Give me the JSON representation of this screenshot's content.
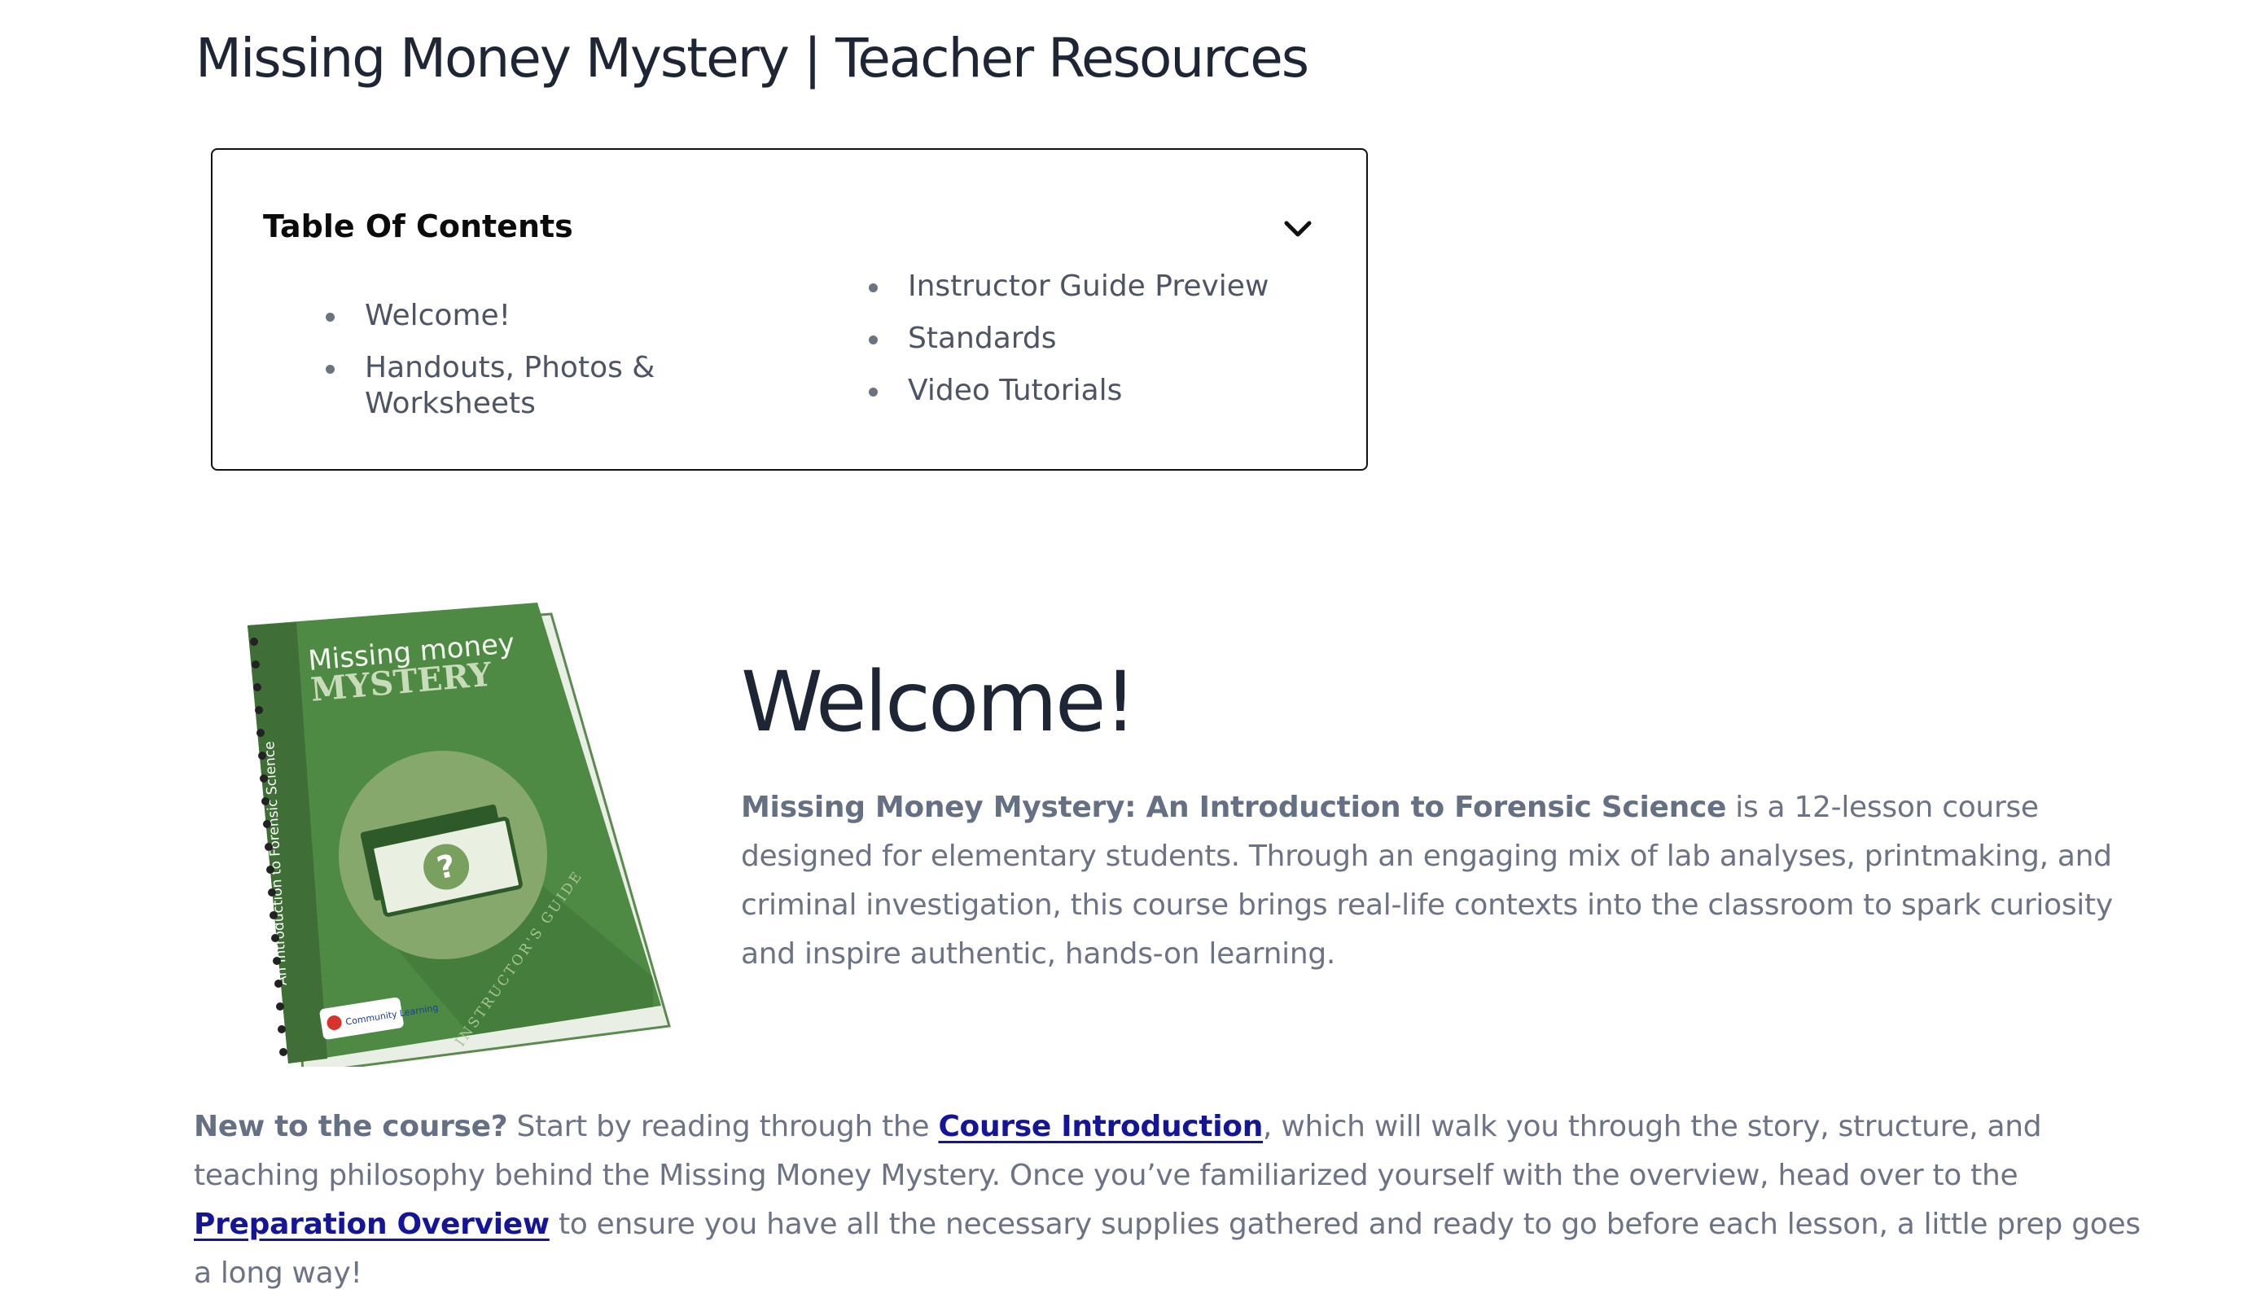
{
  "page": {
    "title": "Missing Money Mystery | Teacher Resources"
  },
  "toc": {
    "title": "Table Of Contents",
    "toggle_icon": "chevron-down-icon",
    "left_items": [
      "Welcome!",
      "Handouts, Photos & Worksheets"
    ],
    "right_items": [
      "Instructor Guide Preview",
      "Standards",
      "Video Tutorials"
    ]
  },
  "cover": {
    "title_line1": "Missing money",
    "title_line2": "MYSTERY",
    "spine_text": "An Introduction to Forensic Science",
    "badge_text": "INSTRUCTOR'S GUIDE",
    "logo_text": "Community Learning",
    "colors": {
      "green_dark": "#3f6f36",
      "green_main": "#4e8a44",
      "circle": "#86a86c"
    }
  },
  "welcome": {
    "heading": "Welcome!",
    "bold_lead": "Missing Money Mystery: An Introduction to Forensic Science",
    "body": " is a 12-lesson course designed for elementary students. Through an engaging mix of lab analyses, printmaking, and criminal investigation, this course brings real-life contexts into the classroom to spark curiosity and inspire authentic, hands-on learning."
  },
  "intro": {
    "bold_lead": "New to the course?",
    "text_1": " Start by reading through the ",
    "link_1": "Course Introduction",
    "text_2": ", which will walk you through the story, structure, and teaching philosophy behind the Missing Money Mystery. Once you’ve familiarized yourself with the overview, head over to the ",
    "link_2": "Preparation Overview",
    "text_3": " to ensure you have all the necessary supplies gathered and ready to go before each lesson, a little prep goes a long way!"
  },
  "colors": {
    "heading": "#1e2635",
    "body_text": "#6b7385",
    "link": "#15159a"
  }
}
